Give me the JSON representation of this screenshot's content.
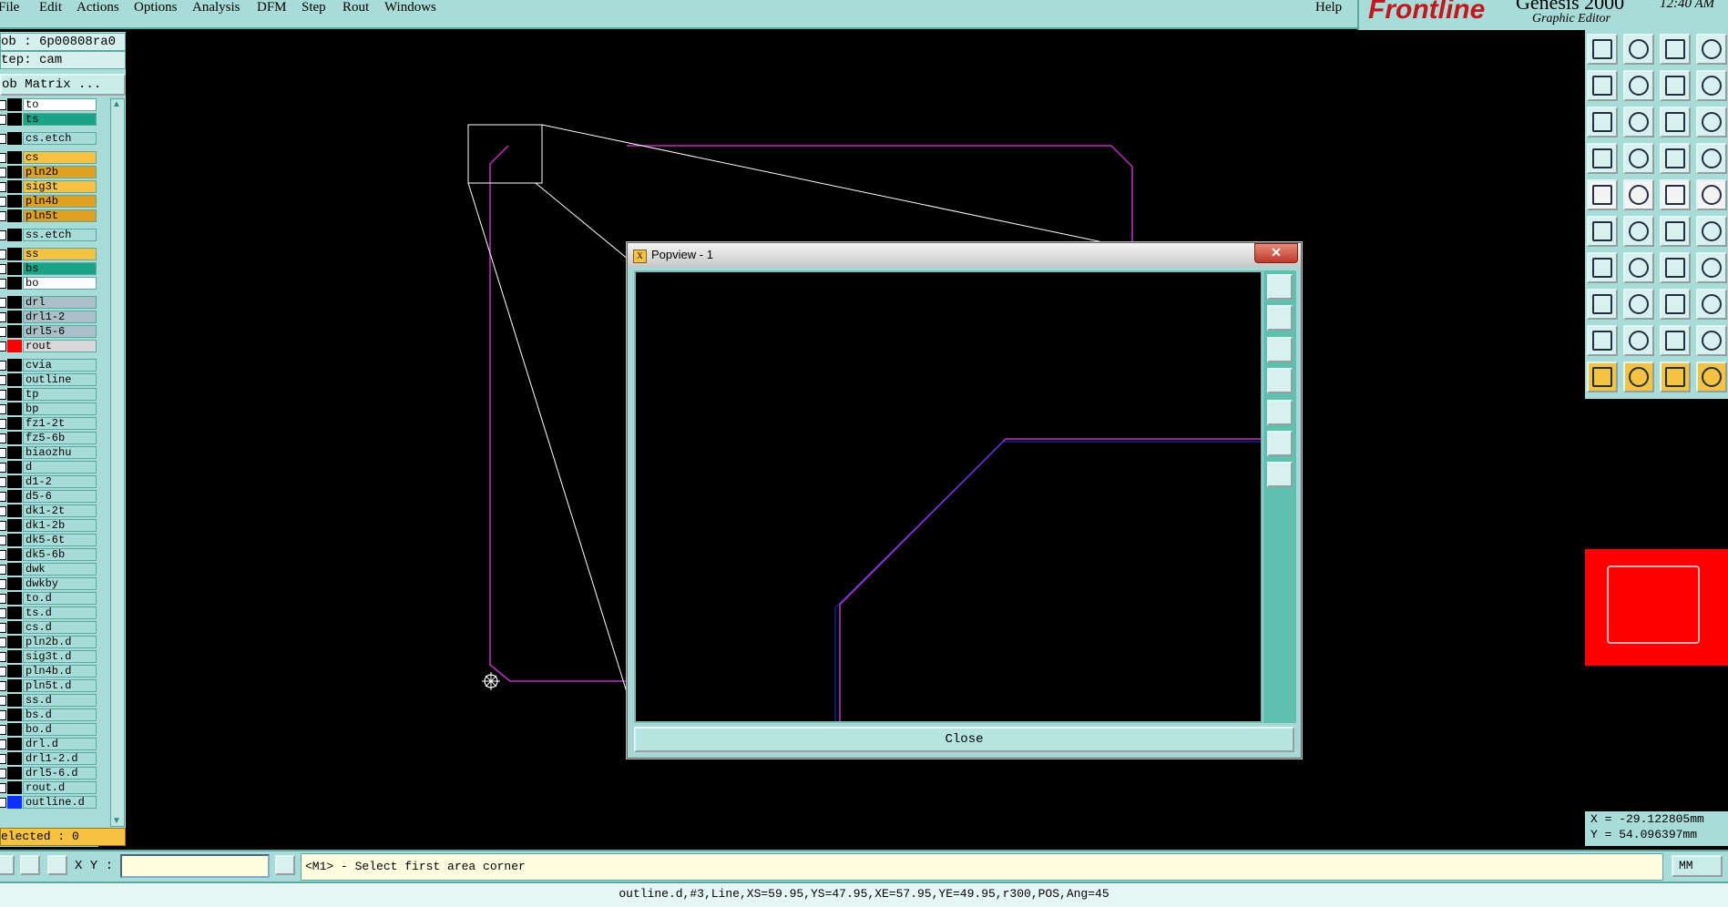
{
  "menu": {
    "items": [
      "File",
      "Edit",
      "Actions",
      "Options",
      "Analysis",
      "DFM",
      "Step",
      "Rout",
      "Windows"
    ],
    "help": "Help"
  },
  "brand": {
    "logo": "Frontline",
    "product": "Genesis 2000",
    "subtitle": "Graphic Editor",
    "time": "12:40 AM"
  },
  "job": {
    "job_field": "ob : 6p00808ra0",
    "step_field": "tep: cam",
    "matrix_button": "ob Matrix ..."
  },
  "layers": [
    {
      "name": "to",
      "color": "#ffffff"
    },
    {
      "name": "ts",
      "color": "#1aa385"
    },
    {
      "name": "cs.etch",
      "color": "#a8dcd8"
    },
    {
      "name": "cs",
      "color": "#f5c242"
    },
    {
      "name": "pln2b",
      "color": "#e0a020"
    },
    {
      "name": "sig3t",
      "color": "#f5c242"
    },
    {
      "name": "pln4b",
      "color": "#e0a020"
    },
    {
      "name": "pln5t",
      "color": "#e0a020"
    },
    {
      "name": "ss.etch",
      "color": "#a8dcd8"
    },
    {
      "name": "ss",
      "color": "#f5c242"
    },
    {
      "name": "bs",
      "color": "#1aa385"
    },
    {
      "name": "bo",
      "color": "#ffffff"
    },
    {
      "name": "drl",
      "color": "#a8c0c8"
    },
    {
      "name": "drl1-2",
      "color": "#a8c0c8"
    },
    {
      "name": "drl5-6",
      "color": "#a8c0c8"
    },
    {
      "name": "rout",
      "color": "#d8d8d8"
    },
    {
      "name": "cvia",
      "color": "#a8dcd8"
    },
    {
      "name": "outline",
      "color": "#a8dcd8"
    },
    {
      "name": "tp",
      "color": "#a8dcd8"
    },
    {
      "name": "bp",
      "color": "#a8dcd8"
    },
    {
      "name": "fz1-2t",
      "color": "#a8dcd8"
    },
    {
      "name": "fz5-6b",
      "color": "#a8dcd8"
    },
    {
      "name": "biaozhu",
      "color": "#a8dcd8"
    },
    {
      "name": "d",
      "color": "#a8dcd8"
    },
    {
      "name": "d1-2",
      "color": "#a8dcd8"
    },
    {
      "name": "d5-6",
      "color": "#a8dcd8"
    },
    {
      "name": "dk1-2t",
      "color": "#a8dcd8"
    },
    {
      "name": "dk1-2b",
      "color": "#a8dcd8"
    },
    {
      "name": "dk5-6t",
      "color": "#a8dcd8"
    },
    {
      "name": "dk5-6b",
      "color": "#a8dcd8"
    },
    {
      "name": "dwk",
      "color": "#a8dcd8"
    },
    {
      "name": "dwkby",
      "color": "#a8dcd8"
    },
    {
      "name": "to.d",
      "color": "#a8dcd8"
    },
    {
      "name": "ts.d",
      "color": "#a8dcd8"
    },
    {
      "name": "cs.d",
      "color": "#a8dcd8"
    },
    {
      "name": "pln2b.d",
      "color": "#a8dcd8"
    },
    {
      "name": "sig3t.d",
      "color": "#a8dcd8"
    },
    {
      "name": "pln4b.d",
      "color": "#a8dcd8"
    },
    {
      "name": "pln5t.d",
      "color": "#a8dcd8"
    },
    {
      "name": "ss.d",
      "color": "#a8dcd8"
    },
    {
      "name": "bs.d",
      "color": "#a8dcd8"
    },
    {
      "name": "bo.d",
      "color": "#a8dcd8"
    },
    {
      "name": "drl.d",
      "color": "#a8dcd8"
    },
    {
      "name": "drl1-2.d",
      "color": "#a8dcd8"
    },
    {
      "name": "drl5-6.d",
      "color": "#a8dcd8"
    },
    {
      "name": "rout.d",
      "color": "#a8dcd8"
    },
    {
      "name": "outline.d",
      "color": "#a8dcd8"
    }
  ],
  "rout_swatch_color": "#ff0000",
  "outline_d_swatch_color": "#1030ff",
  "selected": "elected : 0",
  "popview": {
    "title": "Popview - 1",
    "close_label": "Close",
    "close_glyph": "✕"
  },
  "command": {
    "xy_label": "X Y :",
    "xy_value": "",
    "prompt": "<M1> - Select first area corner",
    "unit": "MM"
  },
  "coords": {
    "x": "X = -29.122805mm",
    "y": "Y = 54.096397mm"
  },
  "status": "outline.d,#3,Line,XS=59.95,YS=47.95,XE=57.95,YE=49.95,r300,POS,Ang=45",
  "colors": {
    "profile_line": "#c030c0",
    "zoom_box": "#ffffff",
    "selected_line": "#2040ff"
  }
}
